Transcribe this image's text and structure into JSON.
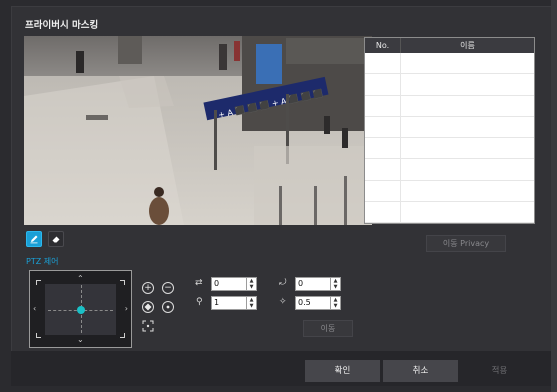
{
  "dialog": {
    "title": "프라이버시 마스킹"
  },
  "privacy_table": {
    "columns": [
      "No.",
      "이름"
    ],
    "rows": [
      {
        "no": "",
        "name": ""
      },
      {
        "no": "",
        "name": ""
      },
      {
        "no": "",
        "name": ""
      },
      {
        "no": "",
        "name": ""
      },
      {
        "no": "",
        "name": ""
      },
      {
        "no": "",
        "name": ""
      },
      {
        "no": "",
        "name": ""
      },
      {
        "no": "",
        "name": ""
      }
    ]
  },
  "video": {
    "sign_text": "+ A ⬛ ⬛ ⬛ + A ⬛ ⬛ ⬛"
  },
  "tools": {
    "draw_icon": "pencil-icon",
    "erase_icon": "eraser-icon"
  },
  "buttons": {
    "move_privacy": "이동 Privacy",
    "move": "이동",
    "ok": "확인",
    "cancel": "취소",
    "apply": "적용"
  },
  "ptz": {
    "label": "PTZ 제어",
    "pan_value": "0",
    "tilt_value": "0",
    "zoom_value": "1",
    "focus_value": "0.5",
    "icons": [
      "zoom-in-icon",
      "zoom-out-icon",
      "focus-near-icon",
      "focus-far-icon",
      "area-zoom-icon"
    ]
  },
  "colors": {
    "accent": "#1a9fd6",
    "joystick_dot": "#1ac0c6",
    "dialog_bg": "#323236",
    "footer_bg": "#26262a"
  }
}
